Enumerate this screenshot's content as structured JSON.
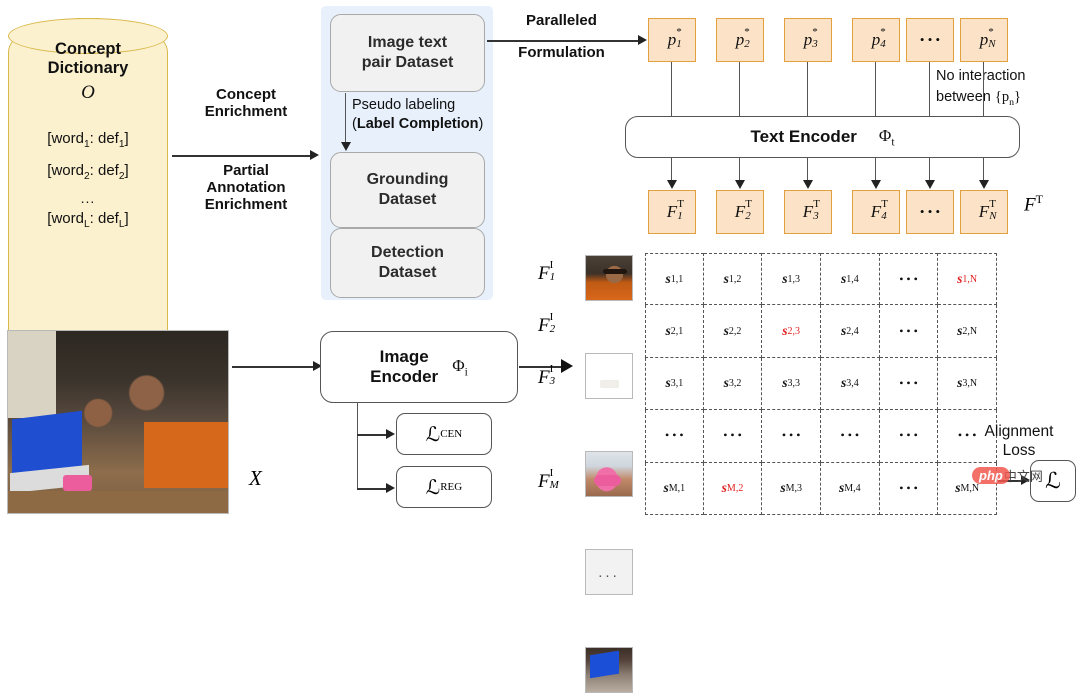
{
  "concept_dictionary": {
    "title_line1": "Concept",
    "title_line2": "Dictionary",
    "symbol": "O",
    "entries": [
      {
        "word": "word",
        "word_sub": "1",
        "def": "def",
        "def_sub": "1"
      },
      {
        "word": "word",
        "word_sub": "2",
        "def": "def",
        "def_sub": "2"
      },
      {
        "word": "word",
        "word_sub": "L",
        "def": "def",
        "def_sub": "L"
      }
    ],
    "ellipsis": "...",
    "bracket_open": "[",
    "bracket_close": "]",
    "separator": ": ",
    "fill_color": "#FCF1CE",
    "border_color": "#D9B84A"
  },
  "enrichment_arrow": {
    "label_above": "Concept\nEnrichment",
    "label_above_l1": "Concept",
    "label_above_l2": "Enrichment",
    "label_below_l1": "Partial",
    "label_below_l2": "Annotation",
    "label_below_l3": "Enrichment"
  },
  "datasets": {
    "container_color": "#E7F0FB",
    "boxes": [
      {
        "line1": "Image text",
        "line2": "pair Dataset"
      },
      {
        "line1": "Grounding",
        "line2": "Dataset"
      },
      {
        "line1": "Detection",
        "line2": "Dataset"
      }
    ],
    "pseudo_label_l1": "Pseudo labeling",
    "pseudo_label_l2_open": "(",
    "pseudo_label_l2_bold": "Label Completion",
    "pseudo_label_l2_close": ")"
  },
  "paralleled_arrow": {
    "label_above": "Paralleled",
    "label_below": "Formulation"
  },
  "prompt_tokens": {
    "fill_color": "#FCE3C8",
    "border_color": "#E2A03F",
    "items": [
      {
        "base": "p",
        "sup": "*",
        "sub": "1"
      },
      {
        "base": "p",
        "sup": "*",
        "sub": "2"
      },
      {
        "base": "p",
        "sup": "*",
        "sub": "3"
      },
      {
        "base": "p",
        "sup": "*",
        "sub": "4"
      },
      {
        "base": "…",
        "sup": "",
        "sub": ""
      },
      {
        "base": "p",
        "sup": "*",
        "sub": "N"
      }
    ]
  },
  "no_interaction_note": {
    "line1": "No interaction",
    "line2_prefix": "between ",
    "line2_set": "{p",
    "line2_sub": "n",
    "line2_close": "}"
  },
  "text_encoder": {
    "label": "Text Encoder",
    "symbol": "Φ",
    "symbol_sub": "t"
  },
  "text_features": {
    "items": [
      {
        "base": "F",
        "sup": "T",
        "sub": "1"
      },
      {
        "base": "F",
        "sup": "T",
        "sub": "2"
      },
      {
        "base": "F",
        "sup": "T",
        "sub": "3"
      },
      {
        "base": "F",
        "sup": "T",
        "sub": "4"
      },
      {
        "base": "…",
        "sup": "",
        "sub": ""
      },
      {
        "base": "F",
        "sup": "T",
        "sub": "N"
      }
    ],
    "group_label_base": "F",
    "group_label_sup": "T"
  },
  "image_encoder": {
    "label_l1": "Image",
    "label_l2": "Encoder",
    "symbol": "Φ",
    "symbol_sub": "i"
  },
  "losses": [
    {
      "base": "ℒ",
      "sub": "CEN"
    },
    {
      "base": "ℒ",
      "sub": "REG"
    }
  ],
  "input_image": {
    "label": "X",
    "description": "photo of a boy and a man at a table with a laptop and a pink phone"
  },
  "image_features": {
    "items": [
      {
        "base": "F",
        "sup": "I",
        "sub": "1",
        "thumb": "man-face-thumbnail"
      },
      {
        "base": "F",
        "sup": "I",
        "sub": "2",
        "thumb": "child-thumbnail"
      },
      {
        "base": "F",
        "sup": "I",
        "sub": "3",
        "thumb": "pink-phone-thumbnail"
      },
      {
        "base": "",
        "sup": "",
        "sub": "",
        "thumb": "blank-ellipsis-thumbnail"
      },
      {
        "base": "F",
        "sup": "I",
        "sub": "M",
        "thumb": "laptop-thumbnail"
      }
    ],
    "blank_ellipsis": "..."
  },
  "similarity_matrix": {
    "rows": [
      [
        {
          "t": "s",
          "r": "1",
          "c": "1",
          "red": false
        },
        {
          "t": "s",
          "r": "1",
          "c": "2",
          "red": false
        },
        {
          "t": "s",
          "r": "1",
          "c": "3",
          "red": false
        },
        {
          "t": "s",
          "r": "1",
          "c": "4",
          "red": false
        },
        {
          "t": "…",
          "r": "",
          "c": "",
          "red": false
        },
        {
          "t": "s",
          "r": "1",
          "c": "N",
          "red": true
        }
      ],
      [
        {
          "t": "s",
          "r": "2",
          "c": "1",
          "red": false
        },
        {
          "t": "s",
          "r": "2",
          "c": "2",
          "red": false
        },
        {
          "t": "s",
          "r": "2",
          "c": "3",
          "red": true
        },
        {
          "t": "s",
          "r": "2",
          "c": "4",
          "red": false
        },
        {
          "t": "…",
          "r": "",
          "c": "",
          "red": false
        },
        {
          "t": "s",
          "r": "2",
          "c": "N",
          "red": false
        }
      ],
      [
        {
          "t": "s",
          "r": "3",
          "c": "1",
          "red": false
        },
        {
          "t": "s",
          "r": "3",
          "c": "2",
          "red": false
        },
        {
          "t": "s",
          "r": "3",
          "c": "3",
          "red": false
        },
        {
          "t": "s",
          "r": "3",
          "c": "4",
          "red": false
        },
        {
          "t": "…",
          "r": "",
          "c": "",
          "red": false
        },
        {
          "t": "s",
          "r": "3",
          "c": "N",
          "red": false
        }
      ],
      [
        {
          "t": "…",
          "r": "",
          "c": "",
          "red": false
        },
        {
          "t": "…",
          "r": "",
          "c": "",
          "red": false
        },
        {
          "t": "…",
          "r": "",
          "c": "",
          "red": false
        },
        {
          "t": "…",
          "r": "",
          "c": "",
          "red": false
        },
        {
          "t": "…",
          "r": "",
          "c": "",
          "red": false
        },
        {
          "t": "…",
          "r": "",
          "c": "",
          "red": false
        }
      ],
      [
        {
          "t": "s",
          "r": "M",
          "c": "1",
          "red": false
        },
        {
          "t": "s",
          "r": "M",
          "c": "2",
          "red": true
        },
        {
          "t": "s",
          "r": "M",
          "c": "3",
          "red": false
        },
        {
          "t": "s",
          "r": "M",
          "c": "4",
          "red": false
        },
        {
          "t": "…",
          "r": "",
          "c": "",
          "red": false
        },
        {
          "t": "s",
          "r": "M",
          "c": "N",
          "red": false
        }
      ]
    ],
    "red_color": "#E02020"
  },
  "alignment_loss": {
    "line1": "Alignment",
    "line2": "Loss",
    "box_symbol": "ℒ"
  },
  "watermark": {
    "badge": "php",
    "text": "中文网"
  }
}
